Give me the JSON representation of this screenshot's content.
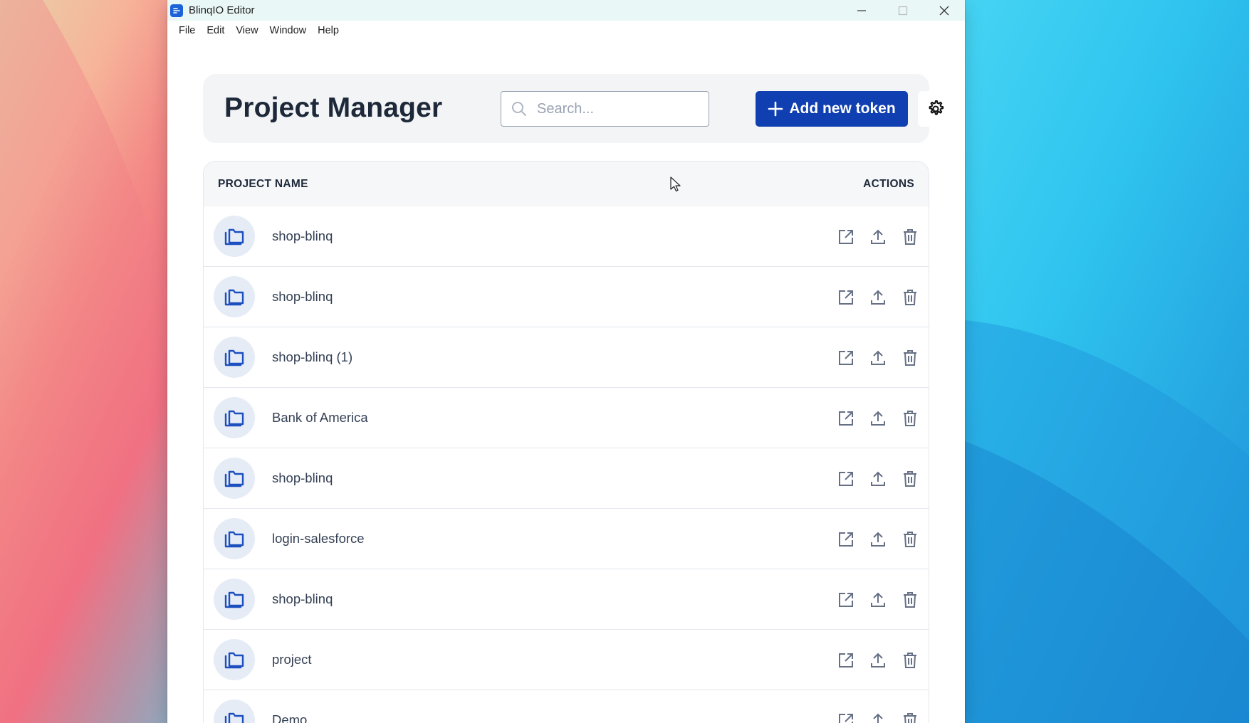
{
  "window": {
    "title": "BlinqIO Editor"
  },
  "menu": [
    "File",
    "Edit",
    "View",
    "Window",
    "Help"
  ],
  "header": {
    "title": "Project Manager",
    "search_placeholder": "Search...",
    "add_button_label": "Add new token"
  },
  "table": {
    "col_project": "PROJECT NAME",
    "col_actions": "ACTIONS",
    "rows": [
      "shop-blinq",
      "shop-blinq",
      "shop-blinq (1)",
      "Bank of America",
      "shop-blinq",
      "login-salesforce",
      "shop-blinq",
      "project",
      "Demo"
    ]
  },
  "colors": {
    "accent": "#0f3fb0",
    "icon": "#1c4fbf"
  }
}
